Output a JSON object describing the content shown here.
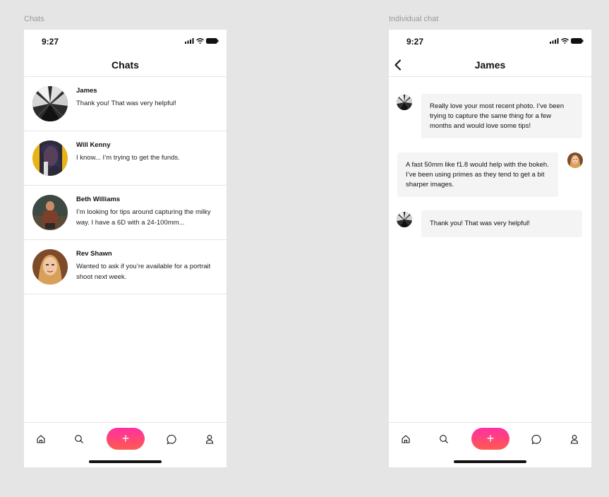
{
  "labels": {
    "left_frame": "Chats",
    "right_frame": "Individual chat"
  },
  "status_bar": {
    "time": "9:27"
  },
  "chats_screen": {
    "title": "Chats",
    "items": [
      {
        "name": "James",
        "preview": "Thank you! That was very helpful!"
      },
      {
        "name": "Will Kenny",
        "preview": "I know... I’m trying to get the funds."
      },
      {
        "name": "Beth Williams",
        "preview": "I’m looking for tips around capturing the milky way. I have a 6D with a 24-100mm..."
      },
      {
        "name": "Rev Shawn",
        "preview": "Wanted to ask if you’re available for a portrait shoot next week."
      }
    ]
  },
  "chat_screen": {
    "title": "James",
    "messages": [
      {
        "from": "james",
        "text": "Really love your most recent photo. I’ve been trying to capture the same thing for a few months and would love some tips!"
      },
      {
        "from": "me",
        "text": "A fast 50mm like f1.8 would help with the bokeh. I’ve been using primes as they tend to get a bit sharper images."
      },
      {
        "from": "james",
        "text": "Thank you! That was very helpful!"
      }
    ]
  },
  "tabbar": {
    "add_label": "+",
    "icons": [
      "home-icon",
      "search-icon",
      "plus-icon",
      "chat-bubble-icon",
      "profile-icon"
    ]
  },
  "colors": {
    "background": "#e5e5e5",
    "bubble": "#f4f4f4",
    "accent_top": "#ff2fa3",
    "accent_bottom": "#ff5a4e"
  }
}
